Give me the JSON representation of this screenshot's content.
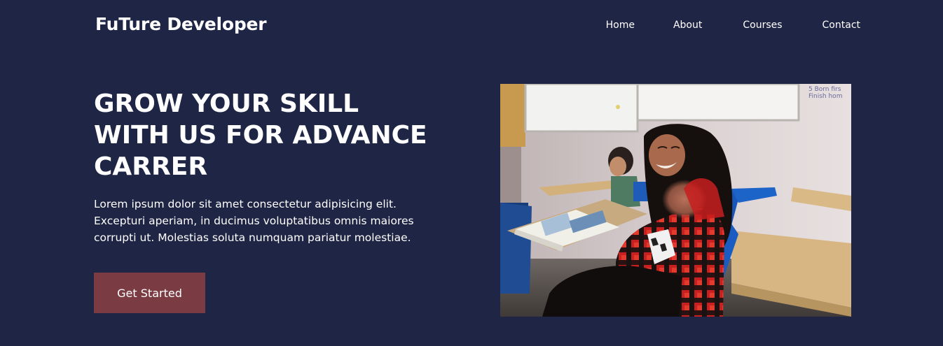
{
  "brand": {
    "name": "FuTure Developer"
  },
  "nav": {
    "items": [
      "Home",
      "About",
      "Courses",
      "Contact"
    ]
  },
  "hero": {
    "headline_lines": [
      "GROW YOUR SKILL",
      "WITH US FOR ADVANCE",
      "CARRER"
    ],
    "description": "Lorem ipsum dolor sit amet consectetur adipisicing elit. Excepturi aperiam, in ducimus voluptatibus omnis maiores corrupti ut. Molestias soluta numquam pariatur molestiae.",
    "cta_label": "Get Started"
  },
  "image": {
    "whiteboard_text": [
      "5 Born firs",
      "Finish hom"
    ]
  },
  "colors": {
    "background": "#1f2544",
    "button": "#7a3b43",
    "text": "#ffffff"
  }
}
